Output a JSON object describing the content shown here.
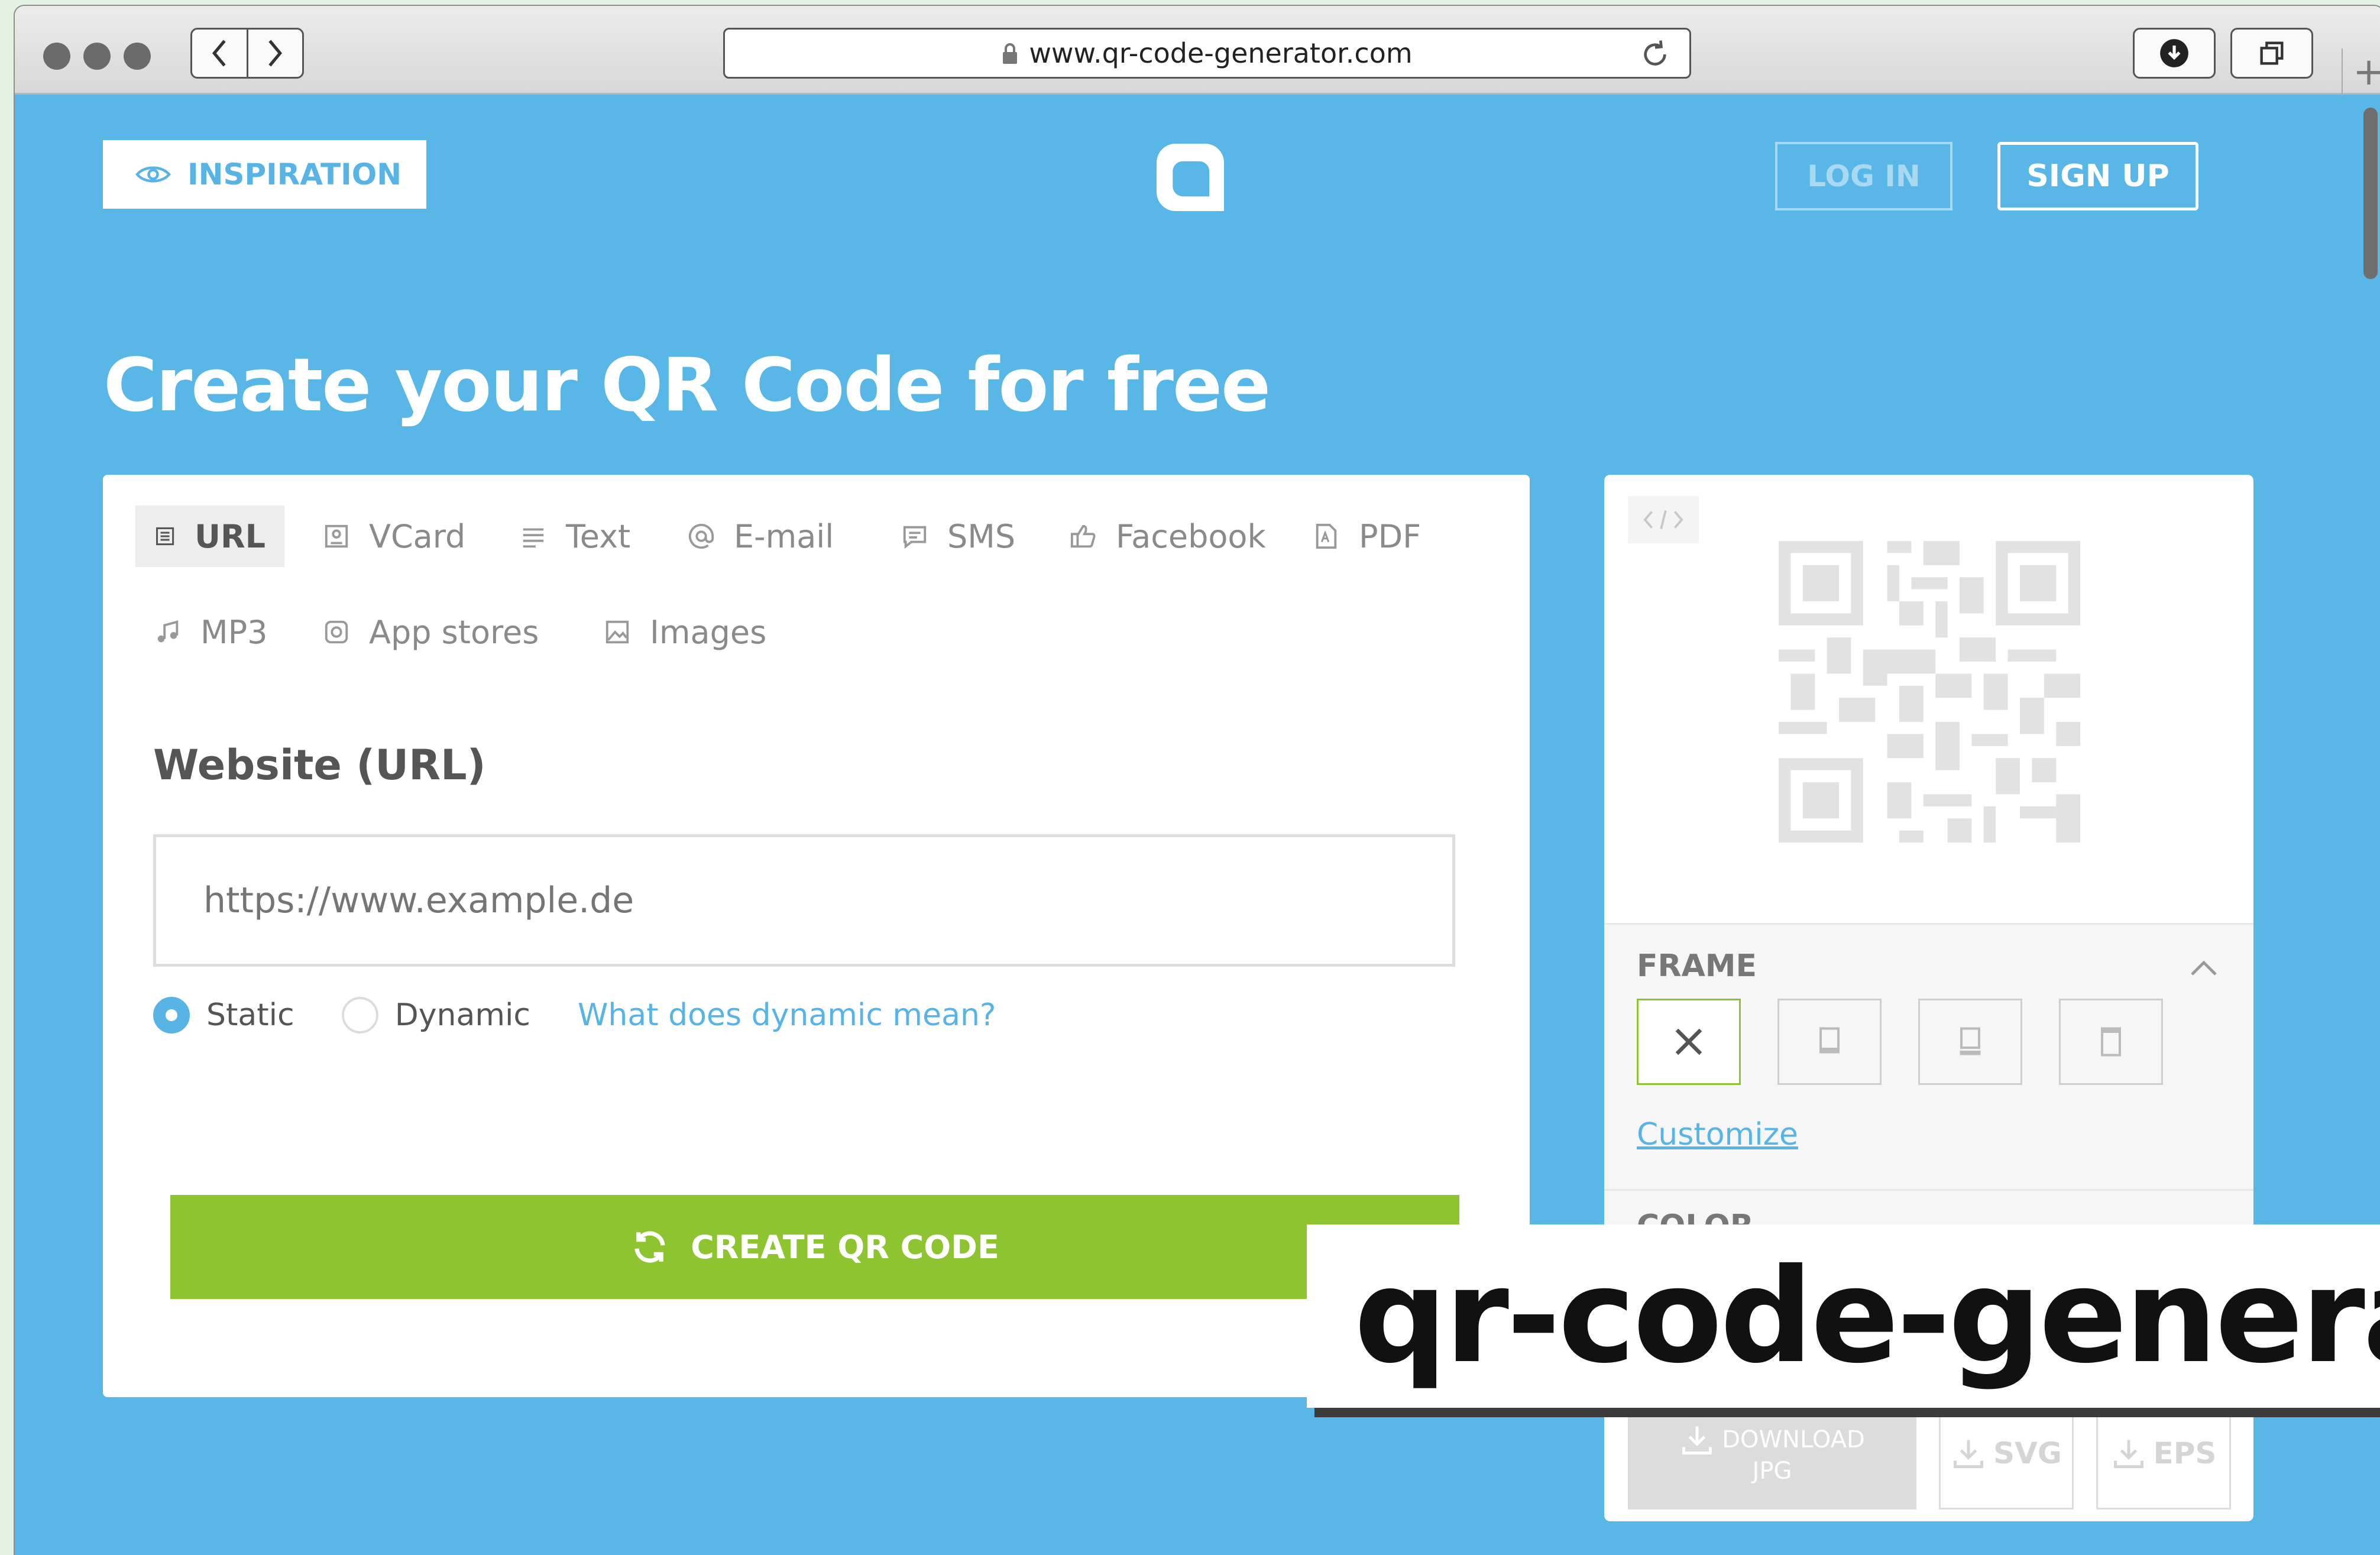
{
  "browser": {
    "url": "www.qr-code-generator.com",
    "new_tab_label": "+"
  },
  "header": {
    "inspiration_label": "INSPIRATION",
    "login_label": "LOG IN",
    "signup_label": "SIGN UP"
  },
  "page_title": "Create your QR Code for free",
  "tabs": [
    {
      "label": "URL",
      "icon": "document-lines-icon",
      "active": true
    },
    {
      "label": "VCard",
      "icon": "contact-card-icon"
    },
    {
      "label": "Text",
      "icon": "text-lines-icon"
    },
    {
      "label": "E-mail",
      "icon": "at-sign-icon"
    },
    {
      "label": "SMS",
      "icon": "speech-bubble-icon"
    },
    {
      "label": "Facebook",
      "icon": "thumbs-up-icon"
    },
    {
      "label": "PDF",
      "icon": "pdf-file-icon"
    },
    {
      "label": "MP3",
      "icon": "music-note-icon"
    },
    {
      "label": "App stores",
      "icon": "app-icon"
    },
    {
      "label": "Images",
      "icon": "image-icon"
    }
  ],
  "form": {
    "field_label": "Website (URL)",
    "url_placeholder": "https://www.example.de",
    "static_label": "Static",
    "dynamic_label": "Dynamic",
    "dynamic_help_link": "What does dynamic mean?",
    "selected_mode": "Static",
    "create_button": "CREATE QR CODE"
  },
  "panel": {
    "frame_title": "FRAME",
    "customize_link": "Customize",
    "color_title": "COLOR",
    "download_jpg_top": "DOWNLOAD",
    "download_jpg_bottom": "JPG",
    "download_svg": "SVG",
    "download_eps": "EPS"
  },
  "caption": "qr-code-generator.com",
  "colors": {
    "page_bg": "#58b7e6",
    "accent_blue": "#57b4e5",
    "create_green": "#8dc42f"
  }
}
